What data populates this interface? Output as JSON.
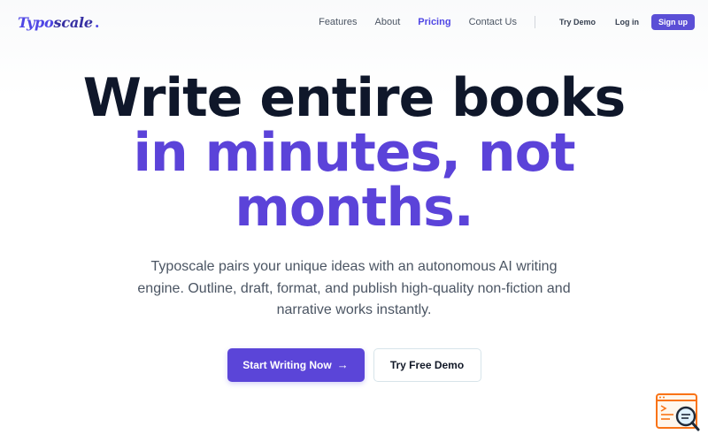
{
  "nav": {
    "logo_main": "Typo",
    "logo_rest": "scale",
    "logo_dot": ".",
    "links": [
      "Features",
      "About",
      "Pricing",
      "Contact Us"
    ],
    "active_link": "Pricing",
    "try_demo": "Try Demo",
    "login": "Log in",
    "signup": "Sign up"
  },
  "hero": {
    "line1": "Write entire books",
    "line2": "in minutes, not",
    "line3": "months.",
    "subtitle": "Typoscale pairs your unique ideas with an autonomous AI writing engine. Outline, draft, format, and publish high-quality non-fiction and narrative works instantly.",
    "primary_cta": "Start Writing Now",
    "primary_cta_icon": "arrow-right-icon",
    "secondary_cta": "Try Free Demo"
  },
  "widget": {
    "icon": "document-search-icon",
    "accent": "#f97316",
    "dark": "#1f2937"
  },
  "colors": {
    "brand": "#5b45d8",
    "heading": "#0f172a",
    "accent_text": "#5b43d9"
  }
}
